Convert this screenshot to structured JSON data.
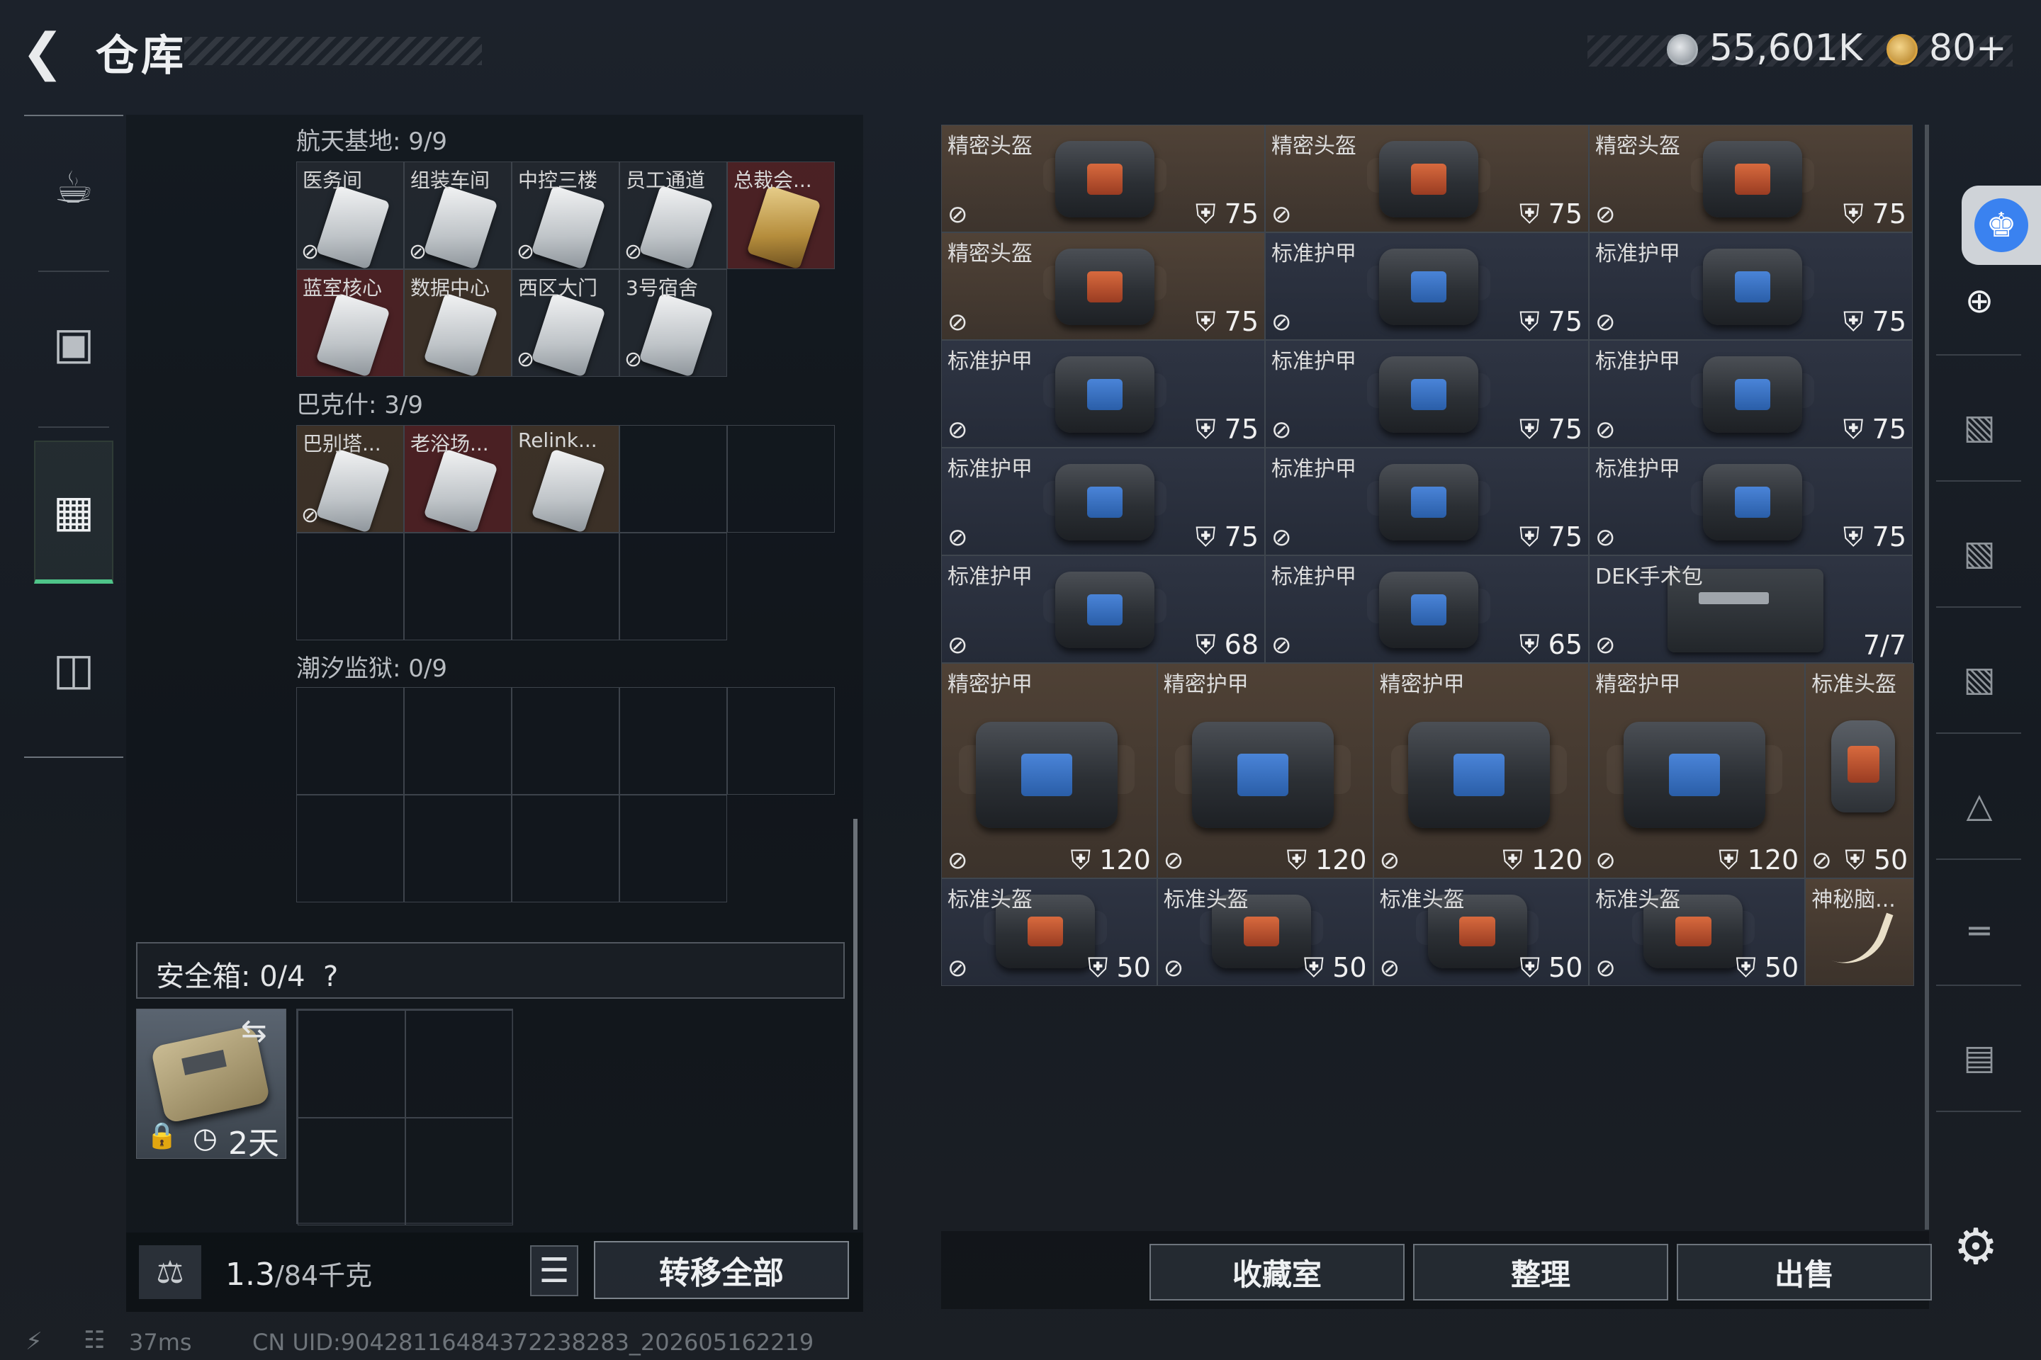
{
  "header": {
    "title": "仓库",
    "currency_silver": "55,601K",
    "currency_gold": "80+"
  },
  "left_nav": [
    "gun-icon",
    "backpack-icon",
    "storage-icon",
    "briefcase-icon"
  ],
  "sections": {
    "space_base": {
      "label": "航天基地: 9/9",
      "cards": [
        "医务间",
        "组装车间",
        "中控三楼",
        "员工通道",
        "总裁会...",
        "蓝室核心",
        "数据中心",
        "西区大门",
        "3号宿舍"
      ]
    },
    "bakesh": {
      "label": "巴克什: 3/9",
      "cards": [
        "巴别塔...",
        "老浴场...",
        "Relink..."
      ]
    },
    "tide_prison": {
      "label": "潮汐监狱: 0/9"
    }
  },
  "safebox": {
    "label": "安全箱: 0/4",
    "help": "?",
    "days": "2天"
  },
  "bottom_left": {
    "weight_current": "1.3",
    "weight_rest": "/84千克",
    "transfer_all": "转移全部"
  },
  "storage": {
    "small_rows": [
      [
        {
          "name": "精密头盔",
          "val": "75",
          "kind": "helm"
        },
        {
          "name": "精密头盔",
          "val": "75",
          "kind": "helm"
        },
        {
          "name": "精密头盔",
          "val": "75",
          "kind": "helm"
        }
      ],
      [
        {
          "name": "精密头盔",
          "val": "75",
          "kind": "helm"
        },
        {
          "name": "标准护甲",
          "val": "75",
          "kind": "armor"
        },
        {
          "name": "标准护甲",
          "val": "75",
          "kind": "armor"
        }
      ],
      [
        {
          "name": "标准护甲",
          "val": "75",
          "kind": "armor"
        },
        {
          "name": "标准护甲",
          "val": "75",
          "kind": "armor"
        },
        {
          "name": "标准护甲",
          "val": "75",
          "kind": "armor"
        }
      ],
      [
        {
          "name": "标准护甲",
          "val": "75",
          "kind": "armor"
        },
        {
          "name": "标准护甲",
          "val": "75",
          "kind": "armor"
        },
        {
          "name": "标准护甲",
          "val": "75",
          "kind": "armor"
        }
      ],
      [
        {
          "name": "标准护甲",
          "val": "68",
          "kind": "armor"
        },
        {
          "name": "标准护甲",
          "val": "65",
          "kind": "armor"
        },
        {
          "name": "DEK手术包",
          "val": "7/7",
          "kind": "medkit"
        }
      ]
    ],
    "big_row": [
      {
        "name": "精密护甲",
        "val": "120"
      },
      {
        "name": "精密护甲",
        "val": "120"
      },
      {
        "name": "精密护甲",
        "val": "120"
      },
      {
        "name": "精密护甲",
        "val": "120"
      },
      {
        "name": "标准头盔",
        "val": "50"
      }
    ],
    "last_row": [
      {
        "name": "标准头盔",
        "val": "50"
      },
      {
        "name": "标准头盔",
        "val": "50"
      },
      {
        "name": "标准头盔",
        "val": "50"
      },
      {
        "name": "标准头盔",
        "val": "50"
      },
      {
        "name": "神秘脑...",
        "val": ""
      }
    ]
  },
  "right_bar": [
    "helmet-slot-icon",
    "add-armor-icon",
    "armor-slot-icon",
    "armor-slot-icon",
    "armor-slot-icon",
    "helmet-filter-icon",
    "gun-filter-icon",
    "bag-filter-icon"
  ],
  "bottom_right": {
    "collection": "收藏室",
    "organize": "整理",
    "sell": "出售"
  },
  "status_bar": {
    "ping": "37ms",
    "uid": "CN UID:90428116484372238283_202605162219"
  }
}
